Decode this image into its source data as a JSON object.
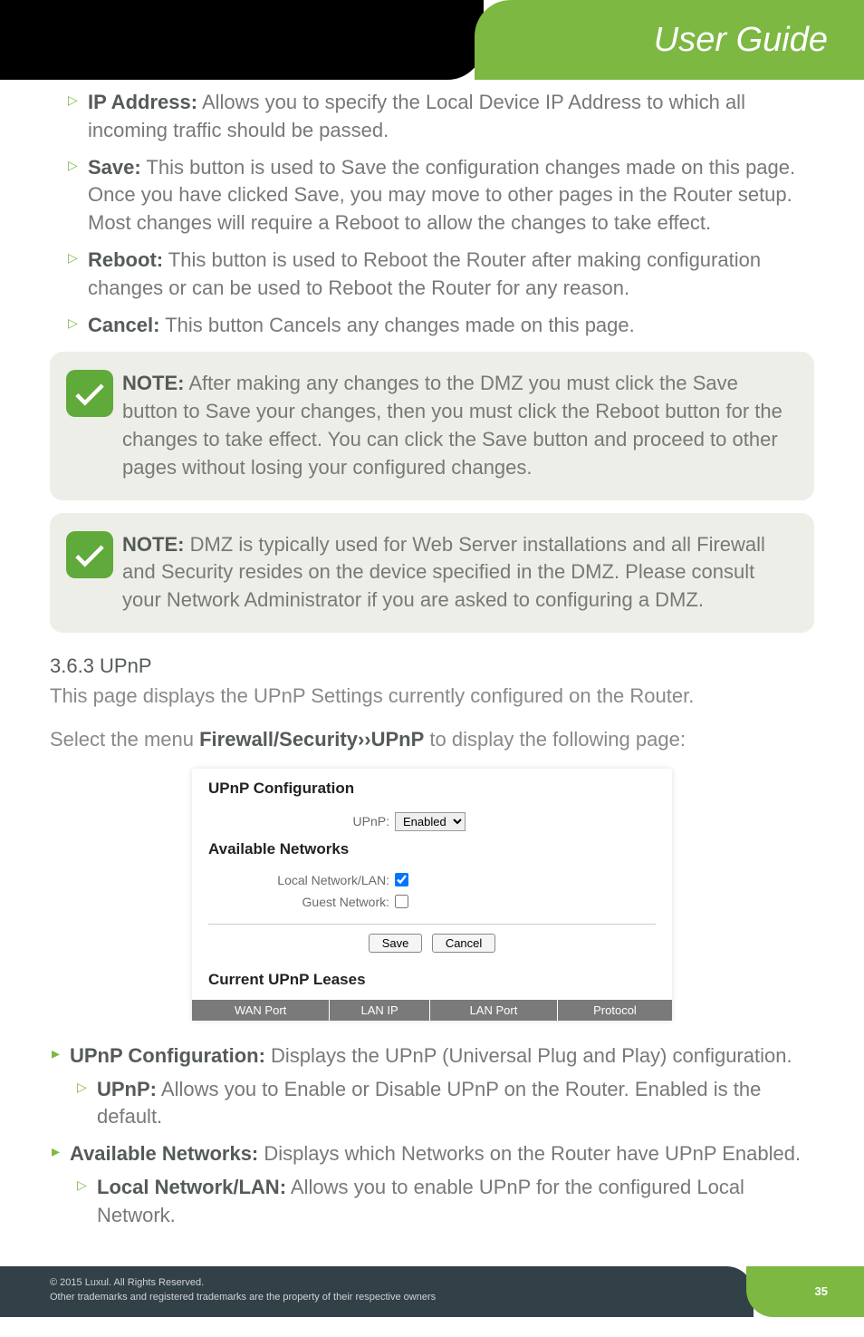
{
  "header": {
    "title": "User Guide"
  },
  "items": {
    "ip_addr": {
      "label": "IP Address:",
      "text": " Allows you to specify the Local Device IP Address to which all incoming traffic should be passed."
    },
    "save": {
      "label": "Save:",
      "text": " This button is used to Save the configuration changes made on this page. Once you have clicked Save, you may move to other pages in the Router setup. Most changes will require a Reboot to allow the changes to take effect."
    },
    "reboot": {
      "label": "Reboot:",
      "text": " This button is used to Reboot the Router after making configuration changes or can be used to Reboot the Router for any reason."
    },
    "cancel": {
      "label": "Cancel:",
      "text": " This button Cancels any changes made on this page."
    }
  },
  "notes": {
    "n1": {
      "label": "NOTE:",
      "text": " After making any changes to the DMZ you must click the Save button to Save your changes, then you must click the Reboot button for the changes to take effect. You can click the Save button and proceed to other pages without losing your configured changes."
    },
    "n2": {
      "label": "NOTE:",
      "text": " DMZ is typically used for Web Server installations and all Firewall and Security resides on the device specified in the DMZ. Please consult your Network Administrator if you are asked to configuring a DMZ."
    }
  },
  "section": {
    "num": "3.6.3 UPnP",
    "intro": "This page displays the UPnP Settings currently configured on the Router.",
    "select_pre": "Select the menu ",
    "select_path": "Firewall/Security››UPnP",
    "select_post": " to display the following page:"
  },
  "panel": {
    "h1": "UPnP Configuration",
    "upnp_lbl": "UPnP:",
    "upnp_val": "Enabled",
    "h2": "Available Networks",
    "lan_lbl": "Local Network/LAN:",
    "guest_lbl": "Guest Network:",
    "save_btn": "Save",
    "cancel_btn": "Cancel",
    "h3": "Current UPnP Leases",
    "cols": {
      "c1": "WAN Port",
      "c2": "LAN IP",
      "c3": "LAN Port",
      "c4": "Protocol"
    }
  },
  "lower": {
    "upnp_cfg": {
      "label": "UPnP Configuration:",
      "text": " Displays the UPnP (Universal Plug and Play) configuration."
    },
    "upnp_sub": {
      "label": "UPnP:",
      "text": " Allows you to Enable or Disable UPnP on the Router. Enabled is the default."
    },
    "avail": {
      "label": "Available Networks:",
      "text": " Displays which Networks on the Router have UPnP Enabled."
    },
    "lan_sub": {
      "label": "Local Network/LAN:",
      "text": " Allows you to enable UPnP for the configured Local Network."
    }
  },
  "footer": {
    "line1": "© 2015  Luxul. All Rights Reserved.",
    "line2": "Other trademarks and registered trademarks are the property of their respective owners",
    "page": "35"
  }
}
